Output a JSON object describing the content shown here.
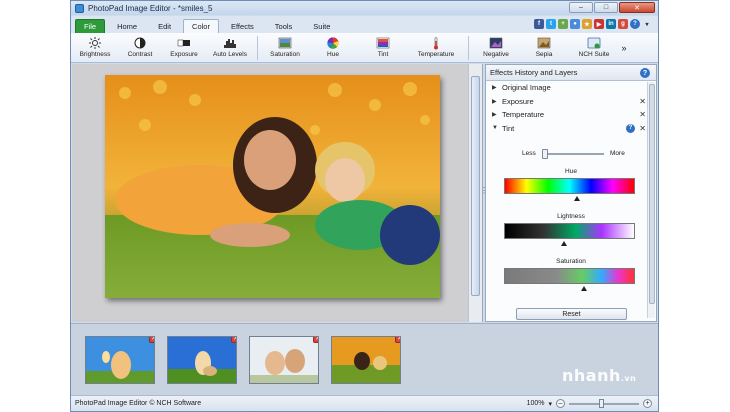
{
  "window": {
    "title": "PhotoPad Image Editor - *smiles_5",
    "minimize": "–",
    "maximize": "□",
    "close": "✕"
  },
  "tabs": [
    "File",
    "Home",
    "Edit",
    "Color",
    "Effects",
    "Tools",
    "Suite"
  ],
  "active_tab": "Color",
  "toolbar": {
    "brightness": "Brightness",
    "contrast": "Contrast",
    "exposure": "Exposure",
    "auto_levels": "Auto Levels",
    "saturation": "Saturation",
    "hue": "Hue",
    "tint": "Tint",
    "temperature": "Temperature",
    "negative": "Negative",
    "sepia": "Sepia",
    "nch_suite": "NCH Suite",
    "more": "»"
  },
  "panel": {
    "title": "Effects History and Layers",
    "help": "?",
    "layers": [
      {
        "label": "Original Image",
        "removable": false
      },
      {
        "label": "Exposure",
        "removable": true
      },
      {
        "label": "Temperature",
        "removable": true
      },
      {
        "label": "Tint",
        "removable": true,
        "expanded": true
      }
    ],
    "less": "Less",
    "more": "More",
    "hue_label": "Hue",
    "lightness_label": "Lightness",
    "saturation_label": "Saturation",
    "reset": "Reset"
  },
  "status": {
    "text": "PhotoPad Image Editor © NCH Software",
    "zoom": "100%",
    "zoom_arrow": "▾",
    "zoom_out": "–",
    "zoom_in": "+"
  },
  "watermark": {
    "brand": "nhanh",
    "tld": ".vn"
  },
  "colors": {
    "file_tab": "#2e9b3a",
    "accent": "#2f6fc4",
    "close_red": "#d9433a"
  }
}
